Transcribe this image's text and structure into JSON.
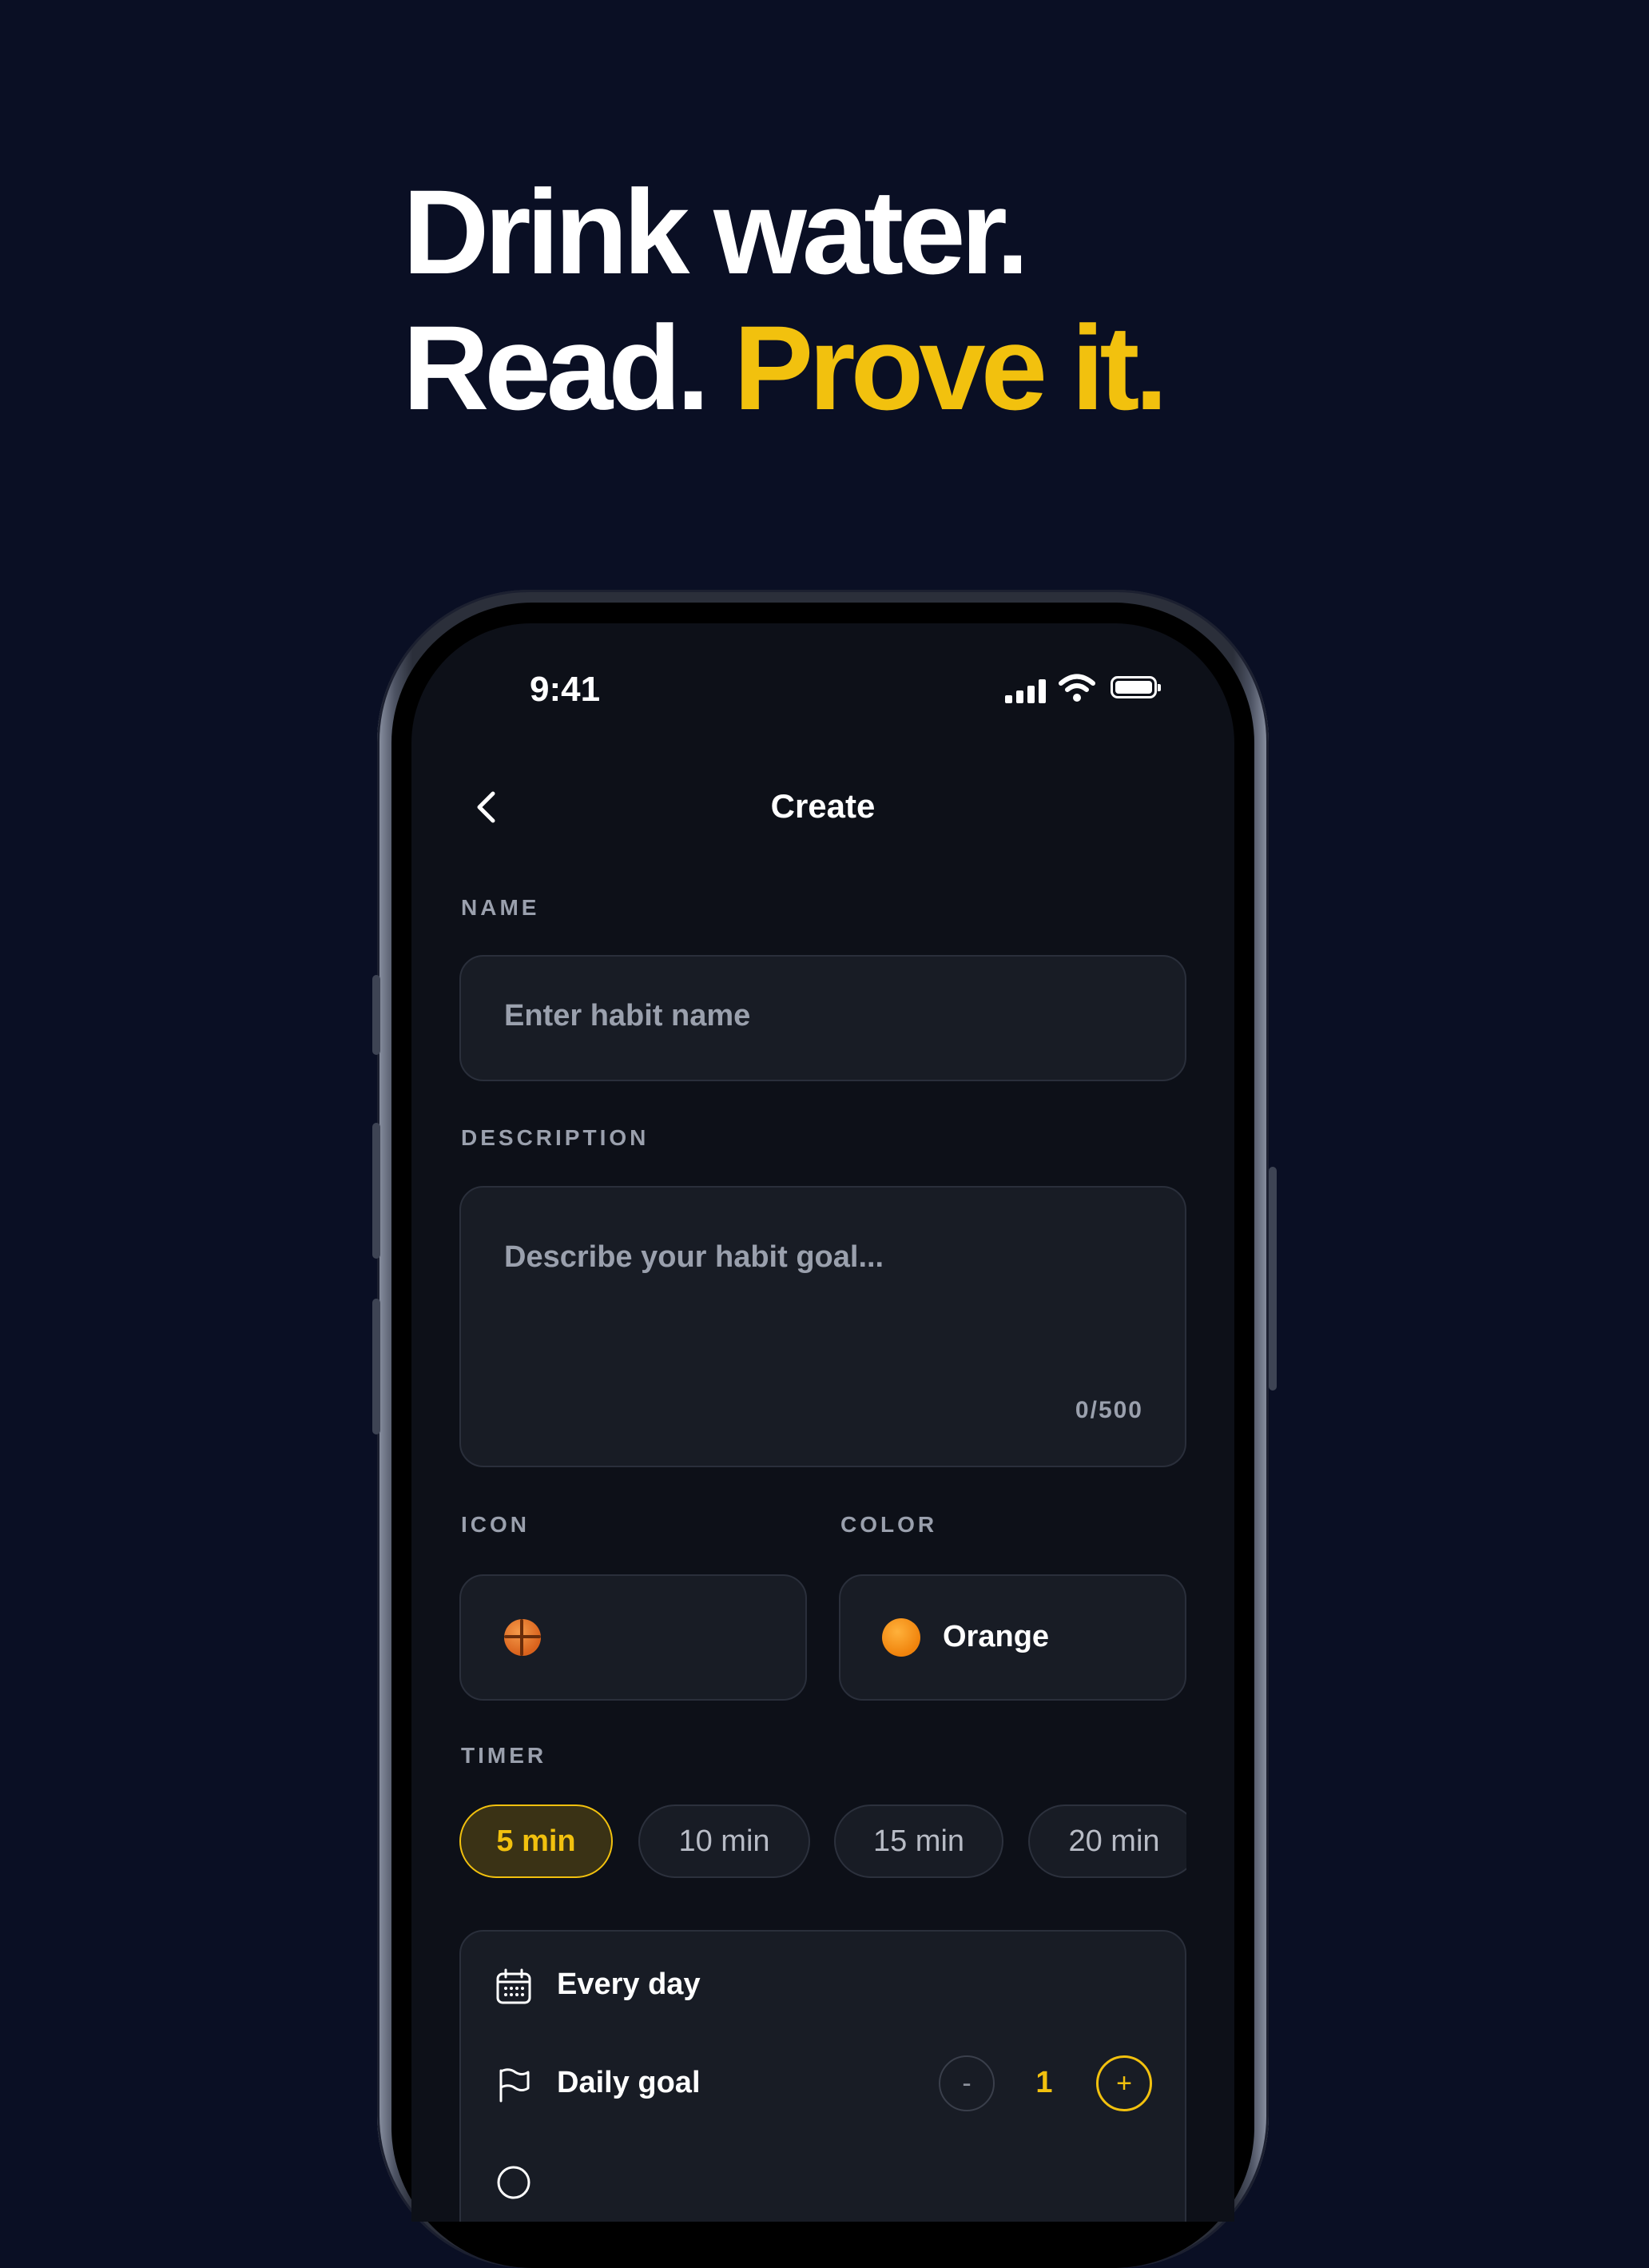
{
  "headline": {
    "line1": "Drink water.",
    "line2_plain": "Read.",
    "line2_accent": "Prove it."
  },
  "colors": {
    "background": "#0a0f24",
    "accent": "#f2c10e",
    "screen": "#0d1018",
    "field": "#181c25"
  },
  "status_bar": {
    "time": "9:41",
    "icons": [
      "signal-icon",
      "wifi-icon",
      "battery-icon"
    ]
  },
  "nav": {
    "back_icon": "chevron-left-icon",
    "title": "Create"
  },
  "form": {
    "name_label": "NAME",
    "name_placeholder": "Enter habit name",
    "description_label": "DESCRIPTION",
    "description_placeholder": "Describe your habit goal...",
    "description_counter": "0/500",
    "icon_label": "ICON",
    "icon_value": "basketball-emoji",
    "color_label": "COLOR",
    "color_value": "Orange",
    "timer_label": "TIMER",
    "timer_options": [
      {
        "label": "5 min",
        "selected": true
      },
      {
        "label": "10 min",
        "selected": false
      },
      {
        "label": "15 min",
        "selected": false
      },
      {
        "label": "20 min",
        "selected": false
      }
    ]
  },
  "settings": {
    "frequency_icon": "calendar-icon",
    "frequency_label": "Every day",
    "goal_icon": "flag-icon",
    "goal_label": "Daily goal",
    "goal_minus": "-",
    "goal_value": "1",
    "goal_plus": "+"
  }
}
